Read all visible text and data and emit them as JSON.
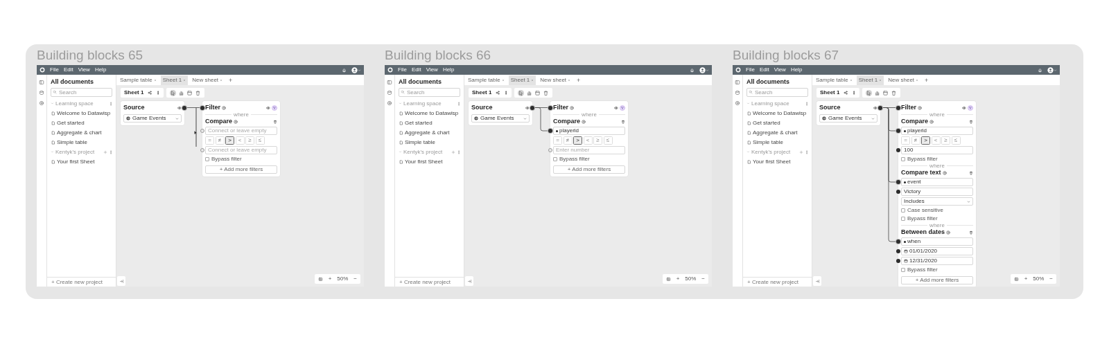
{
  "panels": [
    {
      "title": "Building blocks 65",
      "menu": [
        "File",
        "Edit",
        "View",
        "Help"
      ],
      "tabs": [
        {
          "label": "Sample table",
          "selected": false
        },
        {
          "label": "Sheet 1",
          "selected": true
        },
        {
          "label": "New sheet",
          "selected": false
        }
      ],
      "new_tab": "+",
      "sidebar": {
        "title": "All documents",
        "search_placeholder": "Search",
        "sections": [
          {
            "name": "Learning space",
            "can_add": false,
            "items": [
              "Welcome to Datawisp",
              "Get started",
              "Aggregate & chart",
              "Simple table"
            ]
          },
          {
            "name": "Kentyk's project",
            "can_add": true,
            "items": [
              "Your first Sheet"
            ]
          }
        ],
        "create": "+ Create new project"
      },
      "sheet_name": "Sheet 1",
      "tools": [
        {
          "selected": true
        },
        {
          "selected": false
        },
        {
          "selected": false
        },
        {
          "selected": false
        }
      ],
      "canvas": {
        "dragging": true,
        "source": {
          "title": "Source",
          "dataset": "Game Events",
          "linked": true
        },
        "filter": {
          "title": "Filter",
          "linked": true,
          "add_label": "+ Add more filters",
          "blocks": [
            {
              "connector": "where",
              "title": "Compare",
              "rows": [
                {
                  "kind": "input",
                  "linked": false,
                  "filled": false,
                  "placeholder": "Connect or leave empty"
                },
                {
                  "kind": "ops",
                  "ops": [
                    {
                      "label": "=",
                      "selected": false
                    },
                    {
                      "label": "≠",
                      "selected": false
                    },
                    {
                      "label": ">",
                      "selected": true
                    },
                    {
                      "label": "<",
                      "selected": false
                    },
                    {
                      "label": "≥",
                      "selected": false
                    },
                    {
                      "label": "≤",
                      "selected": false
                    }
                  ]
                },
                {
                  "kind": "input",
                  "linked": false,
                  "filled": false,
                  "placeholder": "Connect or leave empty"
                },
                {
                  "kind": "check",
                  "label": "Bypass filter",
                  "checked": false
                }
              ]
            }
          ]
        }
      },
      "zoom": {
        "plus": "+",
        "value": "50%",
        "minus": "−"
      }
    },
    {
      "title": "Building blocks 66",
      "menu": [
        "File",
        "Edit",
        "View",
        "Help"
      ],
      "tabs": [
        {
          "label": "Sample table",
          "selected": false
        },
        {
          "label": "Sheet 1",
          "selected": true
        },
        {
          "label": "New sheet",
          "selected": false
        }
      ],
      "new_tab": "+",
      "sidebar": {
        "title": "All documents",
        "search_placeholder": "Search",
        "sections": [
          {
            "name": "Learning space",
            "can_add": false,
            "items": [
              "Welcome to Datawisp",
              "Get started",
              "Aggregate & chart",
              "Simple table"
            ]
          },
          {
            "name": "Kentyk's project",
            "can_add": true,
            "items": [
              "Your first Sheet"
            ]
          }
        ],
        "create": "+ Create new project"
      },
      "sheet_name": "Sheet 1",
      "tools": [
        {
          "selected": true
        },
        {
          "selected": false
        },
        {
          "selected": false
        },
        {
          "selected": false
        }
      ],
      "canvas": {
        "dragging": false,
        "source": {
          "title": "Source",
          "dataset": "Game Events",
          "linked": true
        },
        "filter": {
          "title": "Filter",
          "linked": true,
          "add_label": "+ Add more filters",
          "blocks": [
            {
              "connector": "where",
              "title": "Compare",
              "rows": [
                {
                  "kind": "column",
                  "linked": true,
                  "filled": true,
                  "value": "playerid"
                },
                {
                  "kind": "ops",
                  "ops": [
                    {
                      "label": "=",
                      "selected": false
                    },
                    {
                      "label": "≠",
                      "selected": false
                    },
                    {
                      "label": ">",
                      "selected": true
                    },
                    {
                      "label": "<",
                      "selected": false
                    },
                    {
                      "label": "≥",
                      "selected": false
                    },
                    {
                      "label": "≤",
                      "selected": false
                    }
                  ]
                },
                {
                  "kind": "input",
                  "linked": false,
                  "filled": false,
                  "placeholder": "Enter number"
                },
                {
                  "kind": "check",
                  "label": "Bypass filter",
                  "checked": false
                }
              ]
            }
          ]
        }
      },
      "zoom": {
        "plus": "+",
        "value": "50%",
        "minus": "−"
      }
    },
    {
      "title": "Building blocks 67",
      "menu": [
        "File",
        "Edit",
        "View",
        "Help"
      ],
      "tabs": [
        {
          "label": "Sample table",
          "selected": false
        },
        {
          "label": "Sheet 1",
          "selected": true
        },
        {
          "label": "New sheet",
          "selected": false
        }
      ],
      "new_tab": "+",
      "sidebar": {
        "title": "All documents",
        "search_placeholder": "Search",
        "sections": [
          {
            "name": "Learning space",
            "can_add": false,
            "items": [
              "Welcome to Datawisp",
              "Get started",
              "Aggregate & chart",
              "Simple table"
            ]
          },
          {
            "name": "Kentyk's project",
            "can_add": true,
            "items": [
              "Your first Sheet"
            ]
          }
        ],
        "create": "+ Create new project"
      },
      "sheet_name": "Sheet 1",
      "tools": [
        {
          "selected": true
        },
        {
          "selected": false
        },
        {
          "selected": false
        },
        {
          "selected": false
        }
      ],
      "canvas": {
        "dragging": false,
        "source": {
          "title": "Source",
          "dataset": "Game Events",
          "linked": true
        },
        "filter": {
          "title": "Filter",
          "linked": true,
          "add_label": "+ Add more filters",
          "blocks": [
            {
              "connector": "where",
              "title": "Compare",
              "rows": [
                {
                  "kind": "column",
                  "linked": true,
                  "filled": true,
                  "value": "playerid"
                },
                {
                  "kind": "ops",
                  "ops": [
                    {
                      "label": "=",
                      "selected": false
                    },
                    {
                      "label": "≠",
                      "selected": false
                    },
                    {
                      "label": ">",
                      "selected": true
                    },
                    {
                      "label": "<",
                      "selected": false
                    },
                    {
                      "label": "≥",
                      "selected": false
                    },
                    {
                      "label": "≤",
                      "selected": false
                    }
                  ]
                },
                {
                  "kind": "input",
                  "linked": false,
                  "filled": true,
                  "value": "100"
                },
                {
                  "kind": "check",
                  "label": "Bypass filter",
                  "checked": false
                }
              ]
            },
            {
              "connector": "where",
              "title": "Compare text",
              "rows": [
                {
                  "kind": "column",
                  "linked": true,
                  "filled": true,
                  "value": "event"
                },
                {
                  "kind": "input",
                  "linked": false,
                  "filled": true,
                  "value": "Victory"
                },
                {
                  "kind": "select",
                  "value": "Includes"
                },
                {
                  "kind": "check",
                  "label": "Case sensitive",
                  "checked": false
                },
                {
                  "kind": "check",
                  "label": "Bypass filter",
                  "checked": false
                }
              ]
            },
            {
              "connector": "where",
              "title": "Between dates",
              "rows": [
                {
                  "kind": "column",
                  "linked": true,
                  "filled": true,
                  "value": "when"
                },
                {
                  "kind": "date",
                  "linked": false,
                  "filled": true,
                  "value": "01/01/2020"
                },
                {
                  "kind": "date",
                  "linked": false,
                  "filled": true,
                  "value": "12/31/2020"
                },
                {
                  "kind": "check",
                  "label": "Bypass filter",
                  "checked": false
                }
              ]
            }
          ]
        }
      },
      "zoom": {
        "plus": "+",
        "value": "50%",
        "minus": "−"
      }
    }
  ]
}
